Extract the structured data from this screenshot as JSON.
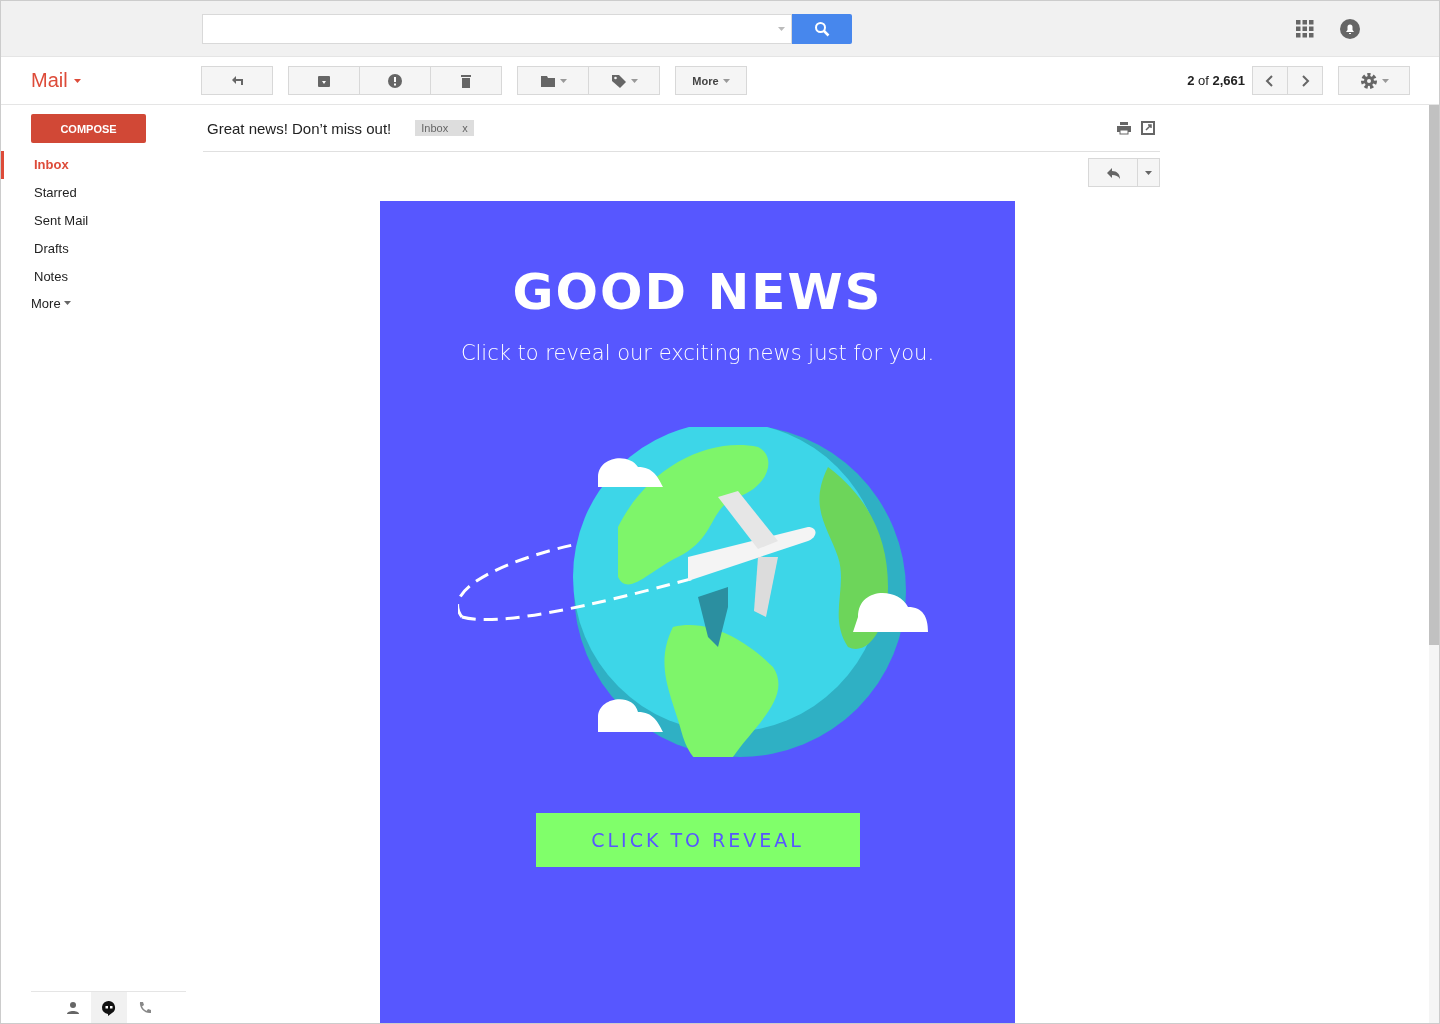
{
  "brand": {
    "label": "Mail"
  },
  "toolbar": {
    "more_label": "More",
    "count": "**2** of **2,661**"
  },
  "compose": {
    "label": "COMPOSE"
  },
  "sidebar": {
    "items": [
      {
        "label": "Inbox",
        "selected": true
      },
      {
        "label": "Starred",
        "selected": false
      },
      {
        "label": "Sent Mail",
        "selected": false
      },
      {
        "label": "Drafts",
        "selected": false
      },
      {
        "label": "Notes",
        "selected": false
      }
    ],
    "more_label": "More"
  },
  "bottom_tabs": [
    {
      "kind": "person",
      "selected": false
    },
    {
      "kind": "chat",
      "selected": true
    },
    {
      "kind": "phone",
      "selected": false
    }
  ],
  "message": {
    "subject": "Great news! Don’t miss out!",
    "label_chip": "Inbox",
    "chip_close": "x"
  },
  "email": {
    "headline": "GOOD NEWS",
    "subtitle": "Click to reveal our exciting news just for you.",
    "cta": "CLICK TO REVEAL"
  }
}
